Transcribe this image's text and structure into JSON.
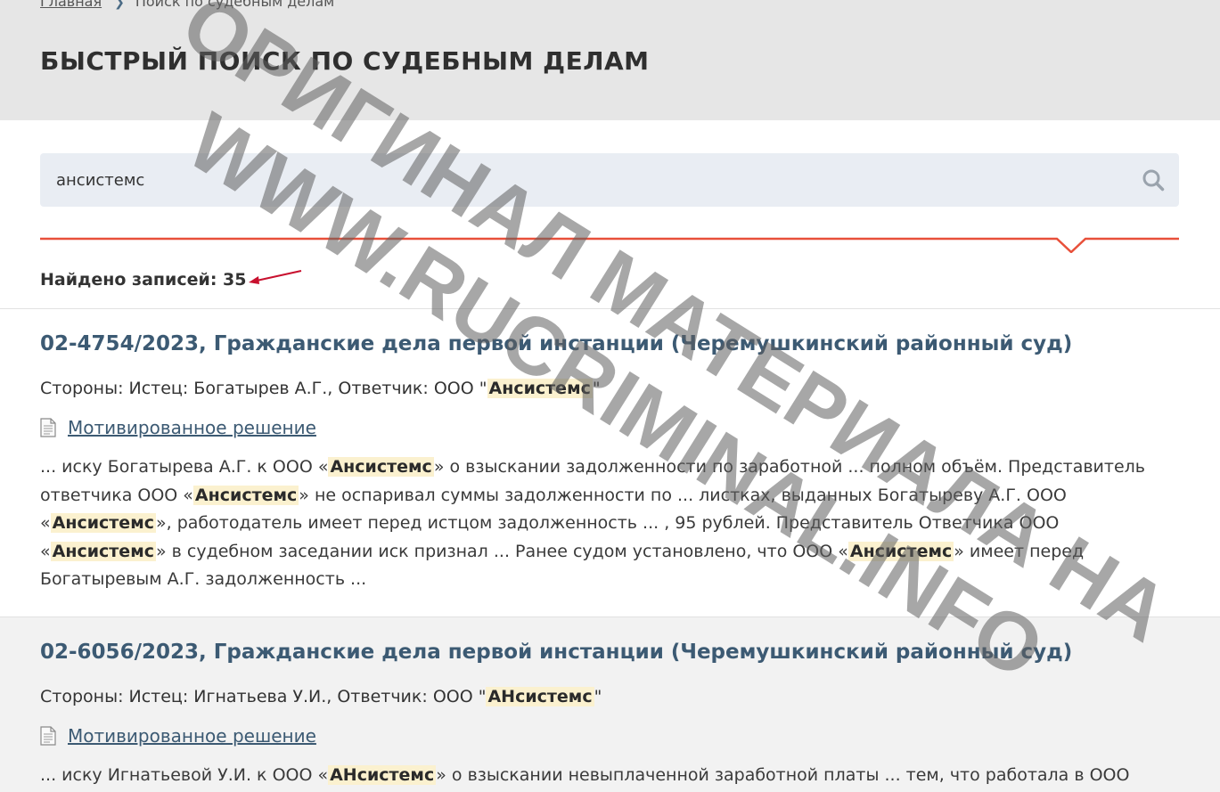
{
  "breadcrumb": {
    "home": "Главная",
    "current": "Поиск по судебным делам"
  },
  "page": {
    "title": "БЫСТРЫЙ ПОИСК ПО СУДЕБНЫМ ДЕЛАМ"
  },
  "search": {
    "value": "ансистемс",
    "icon": "search-icon"
  },
  "results_summary": {
    "label": "Найдено записей: 35"
  },
  "results": [
    {
      "title": "02-4754/2023, Гражданские дела первой инстанции (Черемушкинский районный суд)",
      "parties_prefix": "Стороны: Истец: Богатырев А.Г., Ответчик: ООО \"",
      "parties_highlight": "Ансистемс",
      "parties_suffix": "\"",
      "doc_link": "Мотивированное решение",
      "snippet": [
        {
          "t": "... иску Богатырева А.Г. к ООО «"
        },
        {
          "h": "Ансистемс"
        },
        {
          "t": "» о взыскании задолженности по заработной ... полном объём. Представитель ответчика ООО «"
        },
        {
          "h": "Ансистемс"
        },
        {
          "t": "» не оспаривал суммы задолженности по ... листках, выданных Богатыреву А.Г. ООО «"
        },
        {
          "h": "Ансистемс"
        },
        {
          "t": "», работодатель имеет перед истцом задолженность ... , 95 рублей. Представитель Ответчика ООО «"
        },
        {
          "h": "Ансистемс"
        },
        {
          "t": "» в судебном заседании иск признал ... Ранее судом установлено, что ООО «"
        },
        {
          "h": "Ансистемс"
        },
        {
          "t": "» имеет перед Богатыревым А.Г. задолженность ..."
        }
      ]
    },
    {
      "title": "02-6056/2023, Гражданские дела первой инстанции (Черемушкинский районный суд)",
      "parties_prefix": "Стороны: Истец: Игнатьева У.И., Ответчик: ООО \"",
      "parties_highlight": "АНсистемс",
      "parties_suffix": "\"",
      "doc_link": "Мотивированное решение",
      "snippet": [
        {
          "t": "... иску Игнатьевой У.И. к ООО «"
        },
        {
          "h": "АНсистемс"
        },
        {
          "t": "» о взыскании невыплаченной заработной платы ... тем, что работала в ООО"
        }
      ]
    }
  ],
  "watermark": {
    "line1": "ОРИГИНАЛ МАТЕРИАЛА НА",
    "line2": "WWW.RUCRIMINAL.INFO"
  },
  "colors": {
    "header_bg": "#e6e6e6",
    "search_bg": "#e9edf3",
    "accent_red": "#e8503a",
    "link": "#3c5a73",
    "highlight": "#fbf1cf"
  }
}
